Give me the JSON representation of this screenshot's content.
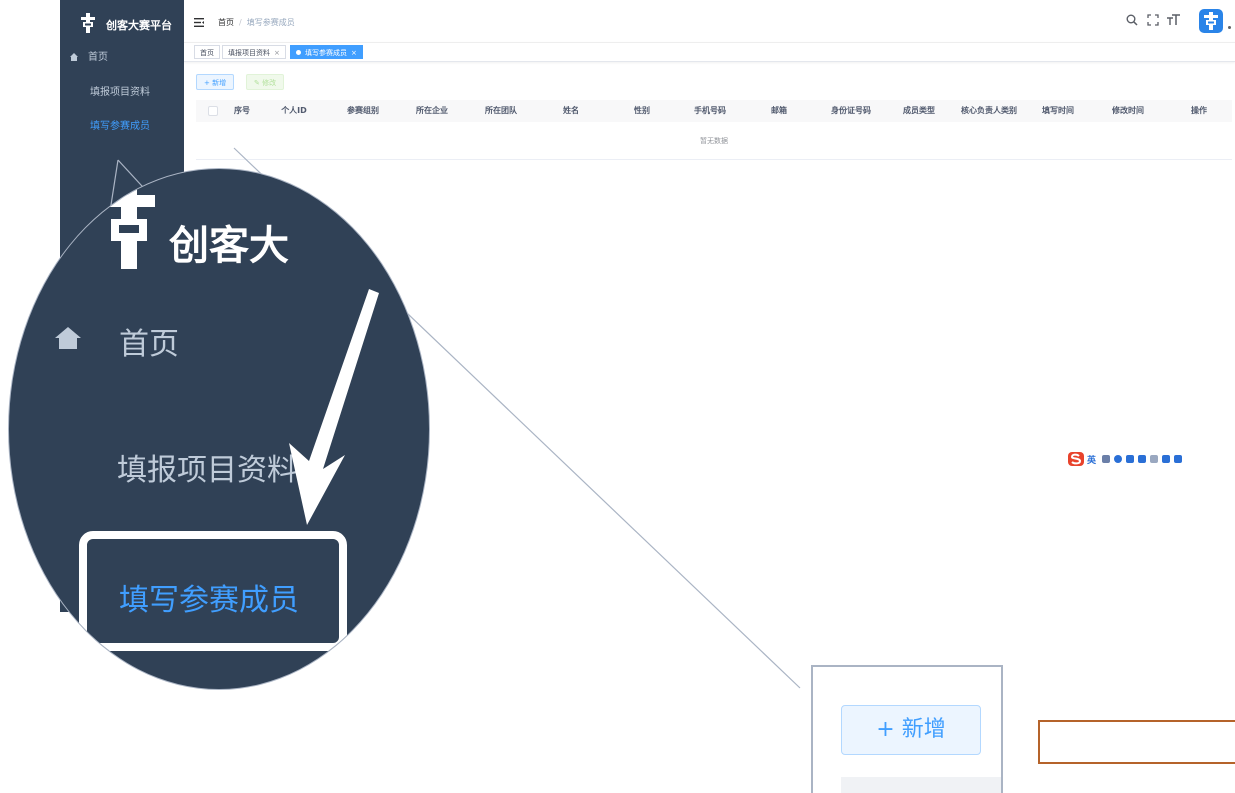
{
  "app": {
    "brand_title": "创客大赛平台"
  },
  "sidebar": {
    "items": [
      {
        "label": "首页",
        "icon": "home-icon",
        "active": false
      },
      {
        "label": "填报项目资料",
        "active": false
      },
      {
        "label": "填写参赛成员",
        "active": true
      }
    ]
  },
  "navbar": {
    "breadcrumb": [
      "首页",
      "/",
      "填写参赛成员"
    ],
    "icons": [
      "search-icon",
      "fullscreen-icon",
      "font-size-icon",
      "avatar",
      "caret-icon"
    ]
  },
  "tags": [
    {
      "label": "首页",
      "closable": false,
      "active": false
    },
    {
      "label": "填报项目资料",
      "closable": true,
      "active": false
    },
    {
      "label": "填写参赛成员",
      "closable": true,
      "active": true
    }
  ],
  "toolbar": {
    "add_label": "+ 新增",
    "edit_label": "✎ 修改"
  },
  "table": {
    "columns": [
      "序号",
      "个人ID",
      "参赛组别",
      "所在企业",
      "所在团队",
      "姓名",
      "性别",
      "手机号码",
      "邮箱",
      "身份证号码",
      "成员类型",
      "核心负责人类别",
      "填写时间",
      "修改时间",
      "操作"
    ],
    "empty_text": "暂无数据"
  },
  "ime": {
    "label": "英"
  },
  "callout": {
    "menu_home": "首页",
    "menu_item_1": "填报项目资料",
    "menu_item_2": "填写参赛成员",
    "add_button": "+ 新增"
  },
  "colors": {
    "sidebar_bg": "#304156",
    "accent": "#409eff",
    "highlight_box": "#b5632a"
  }
}
